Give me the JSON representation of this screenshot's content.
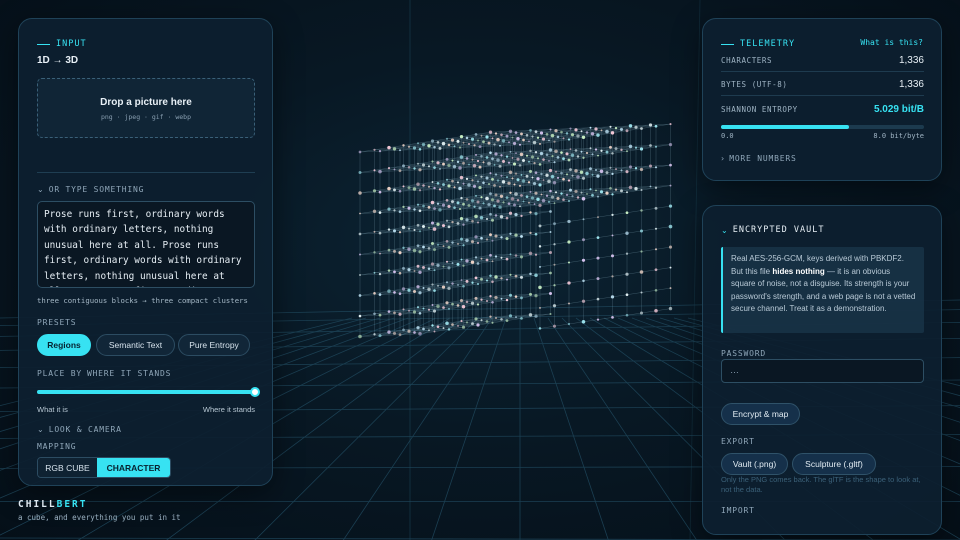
{
  "brand": {
    "name_a": "CHILL",
    "name_b": "BERT",
    "tagline": "a cube, and everything you put in it"
  },
  "input_panel": {
    "section_label": "INPUT",
    "mode_title": "1D → 3D",
    "dropzone": {
      "title": "Drop a picture here",
      "formats": "png · jpeg · gif · webp"
    },
    "type_section": "OR TYPE SOMETHING",
    "text_value": "Prose runs first, ordinary words with ordinary letters, nothing unusual here at all. Prose runs first, ordinary words with ordinary letters, nothing unusual here at all. Prose runs first, ordinary words with",
    "hint": "three contiguous blocks → three compact clusters",
    "presets_label": "PRESETS",
    "presets": [
      "Regions",
      "Semantic Text",
      "Pure Entropy"
    ],
    "active_preset": "Regions",
    "place_by_prefix": "PLACE BY",
    "place_by_value": "WHERE IT STANDS",
    "slider_min_label": "What it is",
    "slider_max_label": "Where it stands",
    "slider_value": 1.0,
    "look_camera": "LOOK & CAMERA",
    "mapping_label": "MAPPING",
    "mapping_options": [
      "RGB CUBE",
      "CHARACTER"
    ],
    "active_mapping": "CHARACTER"
  },
  "telemetry": {
    "section_label": "TELEMETRY",
    "help_link": "What is this?",
    "rows": [
      {
        "key": "CHARACTERS",
        "value": "1,336"
      },
      {
        "key": "BYTES (UTF-8)",
        "value": "1,336"
      },
      {
        "key": "SHANNON ENTROPY",
        "value": "5.029 bit/B"
      }
    ],
    "entropy_fraction": 0.6286,
    "scale_min": "0.0",
    "scale_max": "8.0 bit/byte",
    "more": "MORE NUMBERS"
  },
  "vault": {
    "section_label": "ENCRYPTED VAULT",
    "note_parts": [
      "Real AES-256-GCM, keys derived with PBKDF2. But this file ",
      "hides nothing",
      " — it is an obvious square of noise, not a disguise. Its strength is your password's strength, and a web page is not a vetted secure channel. Treat it as a demonstration."
    ],
    "password_label": "PASSWORD",
    "password_value": "…",
    "encrypt_button": "Encrypt & map",
    "export_label": "EXPORT",
    "export_png": "Vault (.png)",
    "export_gltf": "Sculpture (.gltf)",
    "export_note": "Only the PNG comes back. The glTF is the shape to look at, not the data.",
    "import_label": "IMPORT"
  },
  "colors": {
    "accent": "#37e2f2",
    "background": "#081824",
    "panel": "#0d1f2f"
  },
  "icons": [
    "chevron-down-icon",
    "chevron-right-icon"
  ]
}
